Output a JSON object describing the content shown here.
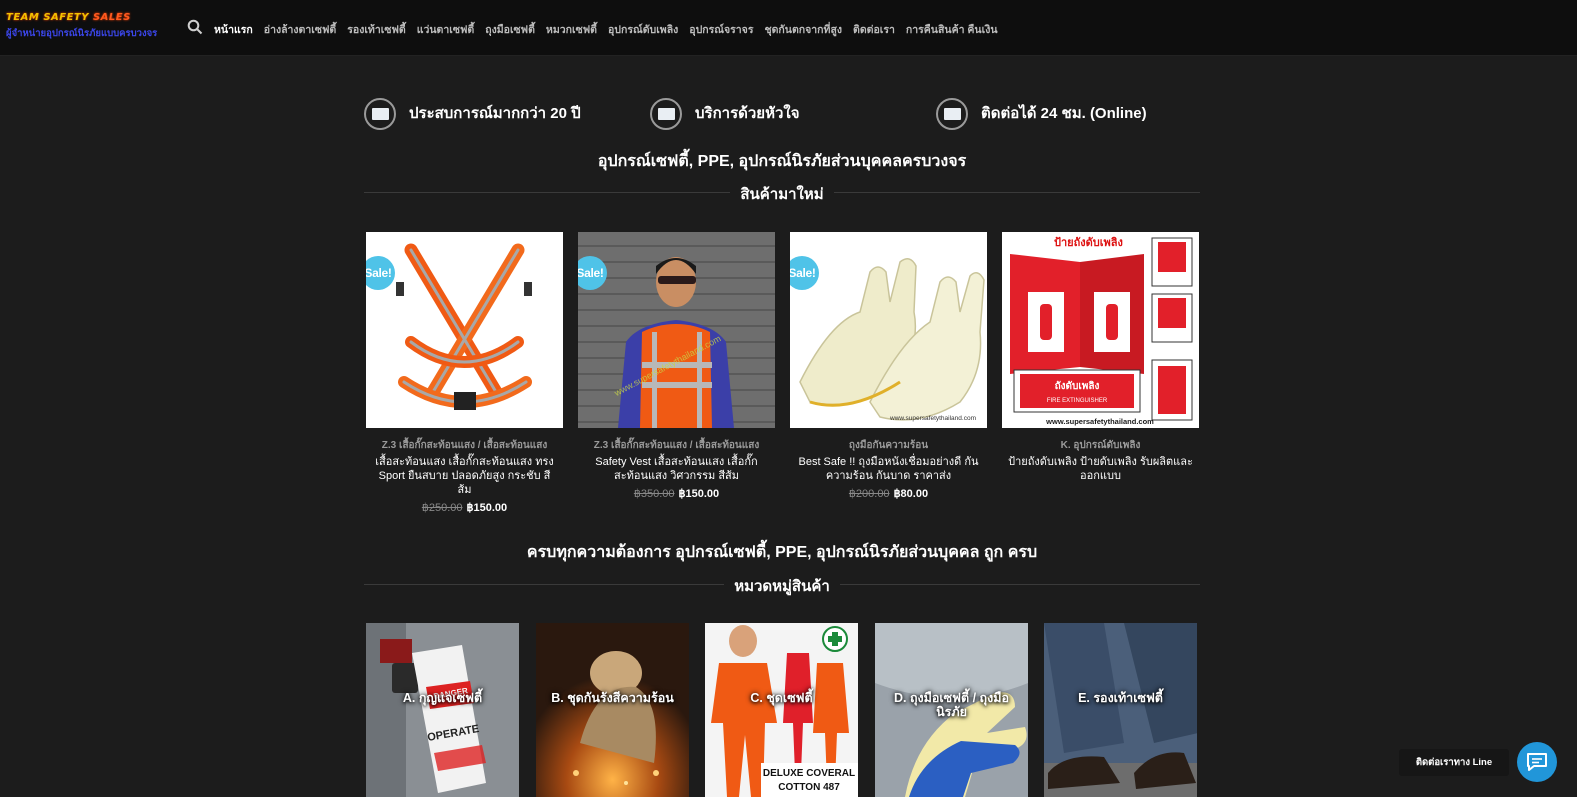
{
  "brand": {
    "logo_text_a": "TEAM SAFETY ",
    "logo_text_b": "SALES",
    "tagline": "ผู้จำหน่ายอุปกรณ์นิรภัยแบบครบวงจร"
  },
  "nav": {
    "items": [
      {
        "label": "หน้าแรก",
        "active": true
      },
      {
        "label": "อ่างล้างตาเซฟตี้"
      },
      {
        "label": "รองเท้าเซฟตี้"
      },
      {
        "label": "แว่นตาเซฟตี้"
      },
      {
        "label": "ถุงมือเซฟตี้"
      },
      {
        "label": "หมวกเซฟตี้"
      },
      {
        "label": "อุปกรณ์ดับเพลิง"
      },
      {
        "label": "อุปกรณ์จราจร"
      },
      {
        "label": "ชุดกันตกจากที่สูง"
      },
      {
        "label": "ติดต่อเรา"
      },
      {
        "label": "การคืนสินค้า คืนเงิน"
      }
    ]
  },
  "features": [
    {
      "text": "ประสบการณ์มากกว่า 20 ปี"
    },
    {
      "text": "บริการด้วยหัวใจ"
    },
    {
      "text": "ติดต่อได้ 24 ชม. (Online)"
    }
  ],
  "headline1": "อุปกรณ์เซฟตี้, PPE, อุปกรณ์นิรภัยส่วนบุคคลครบวงจร",
  "new_products_title": "สินค้ามาใหม่",
  "sale_badge": "Sale!",
  "products": [
    {
      "category": "Z.3 เสื้อกั๊กสะท้อนแสง / เสื้อสะท้อนแสง",
      "name": "เสื้อสะท้อนแสง เสื้อกั๊กสะท้อนแสง ทรง Sport ยืนสบาย ปลอดภัยสูง กระชับ สีส้ม",
      "old_price": "฿250.00",
      "price": "฿150.00",
      "on_sale": true
    },
    {
      "category": "Z.3 เสื้อกั๊กสะท้อนแสง / เสื้อสะท้อนแสง",
      "name": "Safety Vest เสื้อสะท้อนแสง เสื้อกั๊กสะท้อนแสง วิศวกรรม สีส้ม",
      "old_price": "฿350.00",
      "price": "฿150.00",
      "on_sale": true
    },
    {
      "category": "ถุงมือกันความร้อน",
      "name": "Best Safe !! ถุงมือหนังเชื่อมอย่างดี กันความร้อน กันบาด ราคาส่ง",
      "old_price": "฿200.00",
      "price": "฿80.00",
      "on_sale": true
    },
    {
      "category": "K. อุปกรณ์ดับเพลิง",
      "name": "ป้ายถังดับเพลิง ป้ายดับเพลิง รับผลิตและออกแบบ",
      "old_price": "",
      "price": "",
      "on_sale": false,
      "img_title": "ป้ายถังดับเพลิง",
      "img_sign1": "ถังดับเพลิง",
      "img_sign1_en": "FIRE EXTINGUISHER",
      "img_url": "www.supersafetythailand.com"
    }
  ],
  "product_img_texts": {
    "vest_watermark": "www.supersafetythailand.com",
    "glove_url": "www.supersafetythailand.com"
  },
  "headline2": "ครบทุกความต้องการ อุปกรณ์เซฟตี้, PPE, อุปกรณ์นิรภัยส่วนบุคคล ถูก ครบ",
  "categories_title": "หมวดหมู่สินค้า",
  "categories": [
    {
      "label": "A. กุญแจเซฟตี้"
    },
    {
      "label": "B. ชุดกันรังสีความร้อน"
    },
    {
      "label": "C. ชุดเซฟตี้"
    },
    {
      "label": "D. ถุงมือเซฟตี้ / ถุงมือนิรภัย"
    },
    {
      "label": "E. รองเท้าเซฟตี้"
    }
  ],
  "cat_img_texts": {
    "tag_danger": "DANGER",
    "tag_operate": "OPERATE",
    "coverall": "DELUXE COVERAL",
    "coverall2": "COTTON 487"
  },
  "chat": {
    "label": "ติดต่อเราทาง Line"
  },
  "colors": {
    "sale_badge": "#4fc3e8",
    "chat_button": "#2196d9",
    "background": "#1c1c1c"
  }
}
